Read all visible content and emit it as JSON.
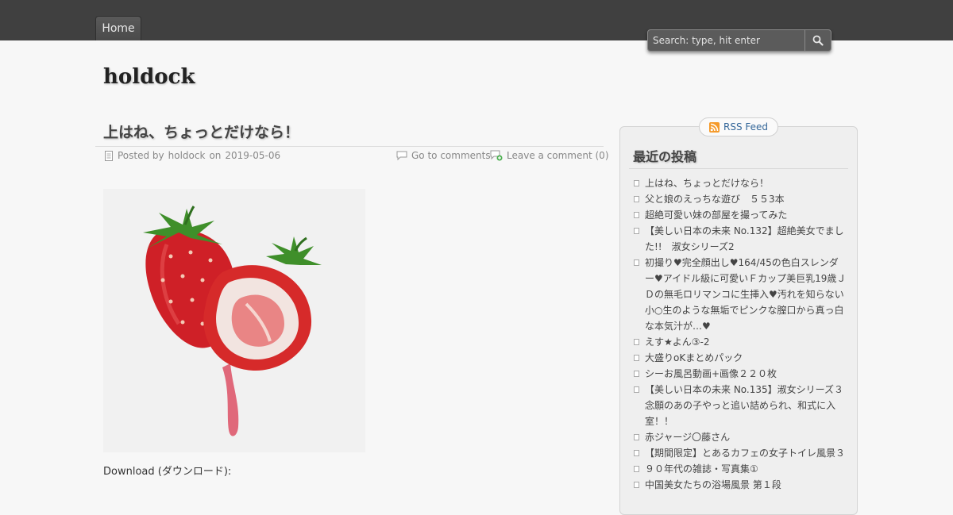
{
  "nav": {
    "home_label": "Home"
  },
  "search": {
    "placeholder": "Search: type, hit enter"
  },
  "site": {
    "title": "holdock"
  },
  "post": {
    "title": "上はね、ちょっとだけなら！",
    "posted_by_prefix": "Posted by",
    "author": "holdock",
    "on_word": "on",
    "date": "2019-05-06",
    "comments_link": "Go to comments",
    "leave_comment": "Leave a comment (0)",
    "download_label": "Download (ダウンロード):"
  },
  "sidebar": {
    "rss_label": "RSS Feed",
    "recent_title": "最近の投稿",
    "recent_posts": [
      "上はね、ちょっとだけなら！",
      "父と娘のえっちな遊び　５５3本",
      "超絶可愛い妹の部屋を撮ってみた",
      "【美しい日本の未来 No.132】超絶美女でました!!　淑女シリーズ2",
      "初撮り♥完全顔出し♥164/45の色白スレンダー♥アイドル級に可愛いＦカップ美巨乳19歳ＪＤの無毛ロリマンコに生挿入♥汚れを知らない小○生のような無垢でピンクな膣口から真っ白な本気汁が…♥",
      "えす★よん③-2",
      "大盛りoKまとめパック",
      "シーお風呂動画+画像２２０枚",
      "【美しい日本の未来 No.135】淑女シリーズ３念願のあの子やっと追い詰められ、和式に入室！！",
      "赤ジャージ〇藤さん",
      "【期間限定】とあるカフェの女子トイレ風景３",
      "９０年代の雑誌・写真集①",
      "中国美女たちの浴場風景 第１段"
    ]
  },
  "colors": {
    "topbar": "#404040",
    "background": "#f7f7f7",
    "link": "#336699",
    "strawberry_red": "#d62a2a",
    "leaf_green": "#3f8f2a"
  },
  "icons": {
    "search": "magnifier-icon",
    "posted": "document-icon",
    "comments": "speech-bubble-icon",
    "leave_comment": "comment-add-icon",
    "rss": "rss-icon"
  }
}
